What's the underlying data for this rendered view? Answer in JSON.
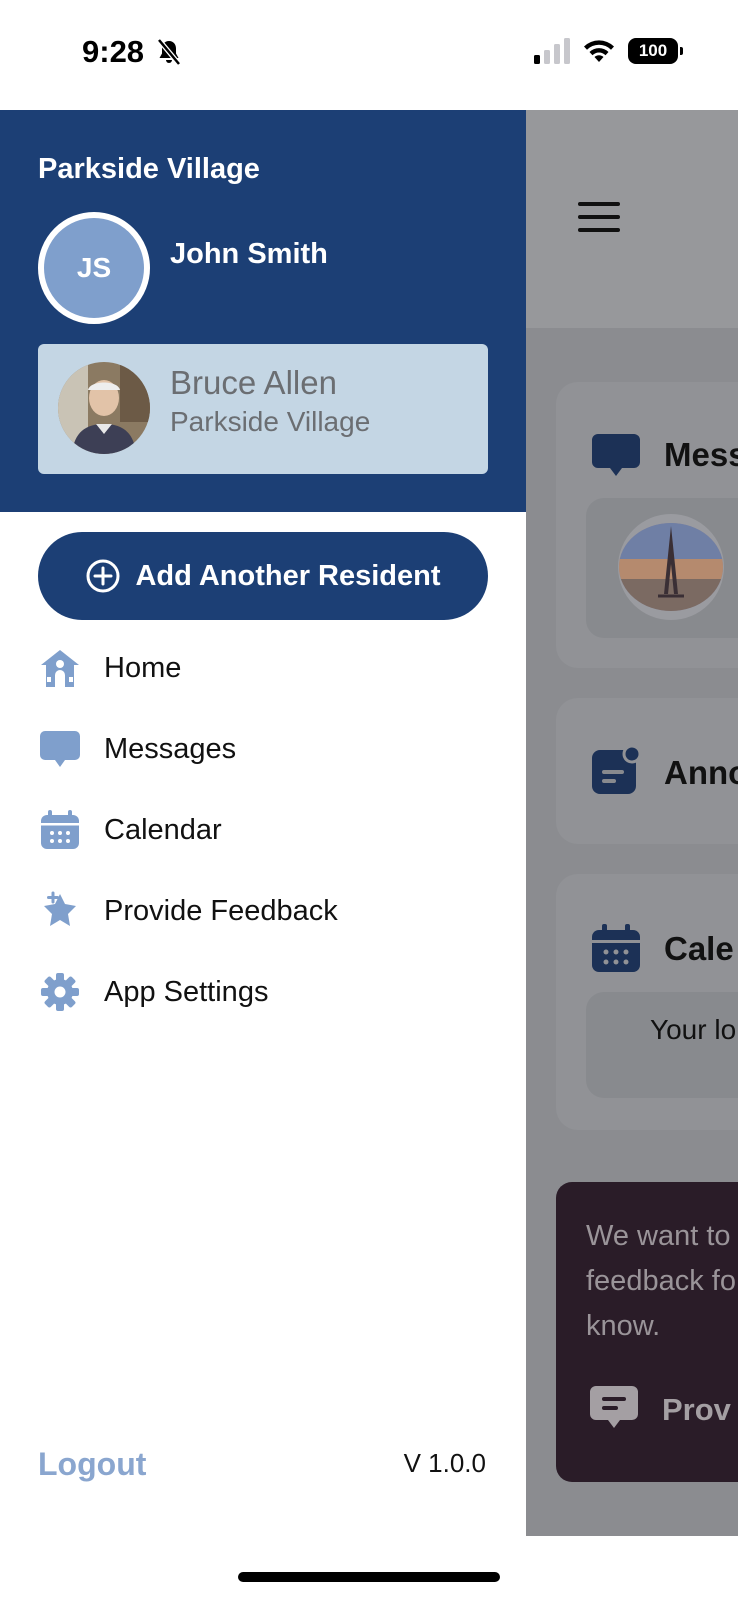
{
  "status_bar": {
    "time": "9:28",
    "battery": "100"
  },
  "drawer": {
    "community_name": "Parkside Village",
    "user": {
      "initials": "JS",
      "name": "John Smith"
    },
    "resident": {
      "name": "Bruce Allen",
      "community": "Parkside Village"
    },
    "add_resident_label": "Add Another Resident",
    "menu": [
      {
        "label": "Home",
        "icon": "home-icon"
      },
      {
        "label": "Messages",
        "icon": "message-bubble-icon"
      },
      {
        "label": "Calendar",
        "icon": "calendar-icon"
      },
      {
        "label": "Provide Feedback",
        "icon": "feedback-star-icon"
      },
      {
        "label": "App Settings",
        "icon": "gear-icon"
      }
    ],
    "logout_label": "Logout",
    "version": "V 1.0.0"
  },
  "background_app": {
    "cards": [
      {
        "title": "Mess"
      },
      {
        "title": "Anno"
      },
      {
        "title": "Cale",
        "inner_text": "Your lo"
      }
    ],
    "feedback_text": "We want to feedback fo know.",
    "feedback_button": "Prov"
  },
  "colors": {
    "primary": "#1c3f75",
    "accent_light": "#7f9fcc",
    "resident_card": "#c4d6e4",
    "logout": "#8aa6cf"
  }
}
